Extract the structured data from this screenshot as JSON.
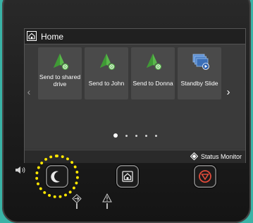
{
  "header": {
    "title": "Home"
  },
  "tiles": [
    {
      "label": "Send to shared drive",
      "icon": "send-shared-drive-icon"
    },
    {
      "label": "Send to John",
      "icon": "send-user-icon"
    },
    {
      "label": "Send to Donna",
      "icon": "send-user-icon"
    },
    {
      "label": "Standby Slide",
      "icon": "slideshow-icon"
    }
  ],
  "pagination": {
    "current": 1,
    "total": 5
  },
  "status_monitor": {
    "label": "Status Monitor"
  },
  "colors": {
    "background": "#39b3a6",
    "accent_green": "#59b84a",
    "stop_red": "#e04a3a",
    "highlight_yellow": "#ffe600"
  }
}
